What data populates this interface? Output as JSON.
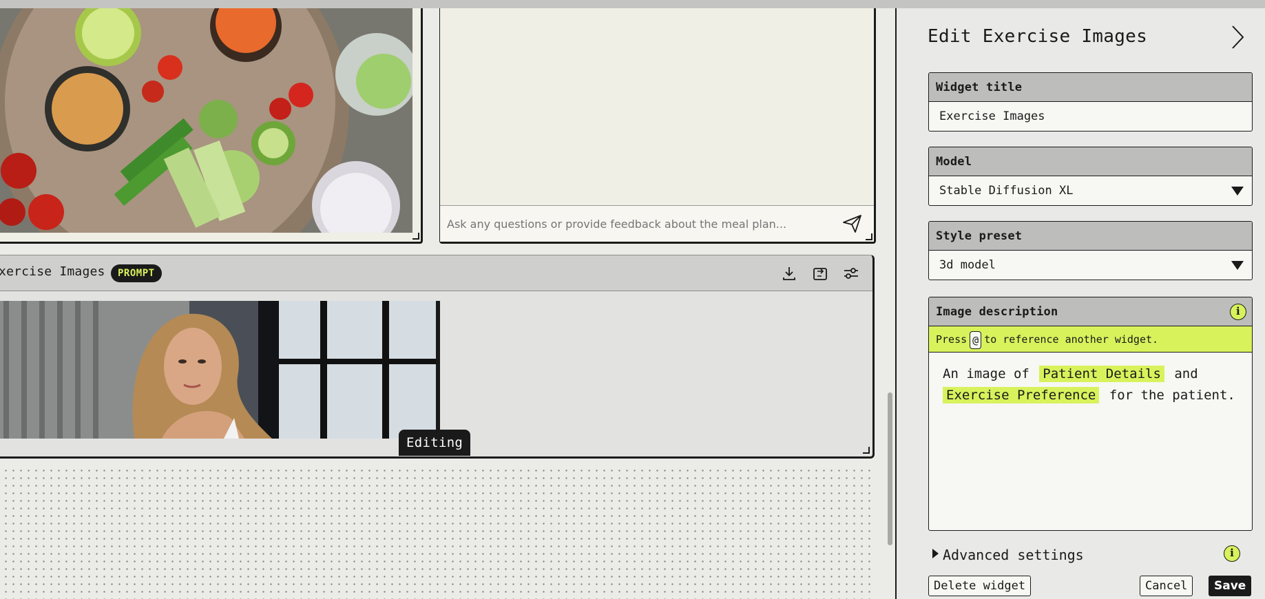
{
  "canvas": {
    "chat": {
      "input_placeholder": "Ask any questions or provide feedback about the meal plan..."
    },
    "exercise_widget": {
      "title": "Exercise Images",
      "badge": "PROMPT",
      "editing_label": "Editing",
      "header_icons": [
        "download-icon",
        "export-icon",
        "settings-sliders-icon"
      ]
    }
  },
  "panel": {
    "title": "Edit Exercise Images",
    "fields": {
      "widget_title": {
        "label": "Widget title",
        "value": "Exercise Images"
      },
      "model": {
        "label": "Model",
        "value": "Stable Diffusion XL"
      },
      "style_preset": {
        "label": "Style preset",
        "value": "3d model"
      },
      "image_description": {
        "label": "Image description",
        "hint_before": "Press",
        "hint_key": "@",
        "hint_after": "to reference another widget.",
        "text_1": "An image of",
        "ref_1": "Patient Details",
        "text_2": "and",
        "ref_2": "Exercise Preference",
        "text_3": "for the patient."
      }
    },
    "advanced_settings": "Advanced settings",
    "buttons": {
      "delete": "Delete widget",
      "cancel": "Cancel",
      "save": "Save"
    }
  },
  "colors": {
    "accent": "#d8f25c",
    "dark": "#1a1a1a",
    "panel_bg": "#e9e9e7"
  }
}
